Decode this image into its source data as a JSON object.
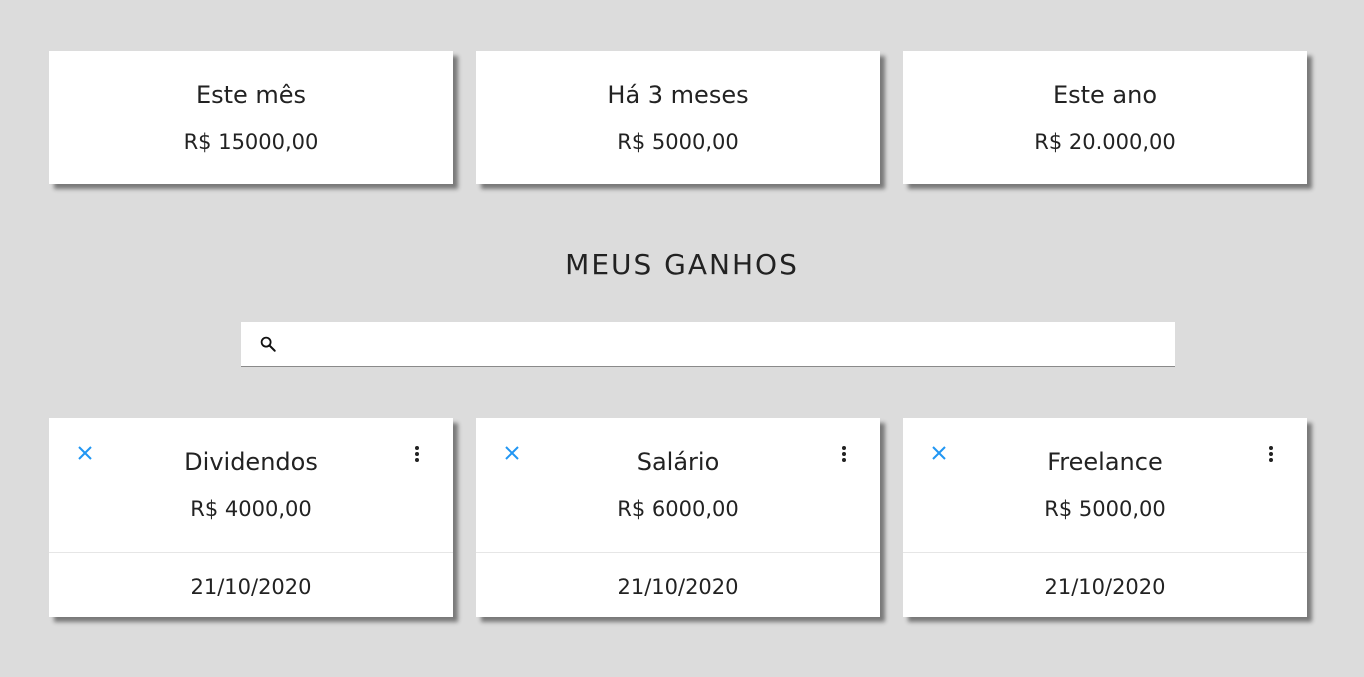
{
  "summary": [
    {
      "label": "Este mês",
      "value": "R$ 15000,00"
    },
    {
      "label": "Há 3 meses",
      "value": "R$ 5000,00"
    },
    {
      "label": "Este ano",
      "value": "R$ 20.000,00"
    }
  ],
  "page_title": "MEUS GANHOS",
  "search": {
    "value": "",
    "placeholder": "",
    "icon": "search-icon"
  },
  "incomes": [
    {
      "title": "Dividendos",
      "value": "R$ 4000,00",
      "date": "21/10/2020"
    },
    {
      "title": "Salário",
      "value": "R$ 6000,00",
      "date": "21/10/2020"
    },
    {
      "title": "Freelance",
      "value": "R$ 5000,00",
      "date": "21/10/2020"
    }
  ],
  "colors": {
    "background": "#dcdcdc",
    "card": "#ffffff",
    "delete_icon": "#2196f3",
    "text": "#222222"
  },
  "icons": {
    "delete": "close-icon",
    "menu": "more-vertical-icon",
    "search": "search-icon"
  }
}
